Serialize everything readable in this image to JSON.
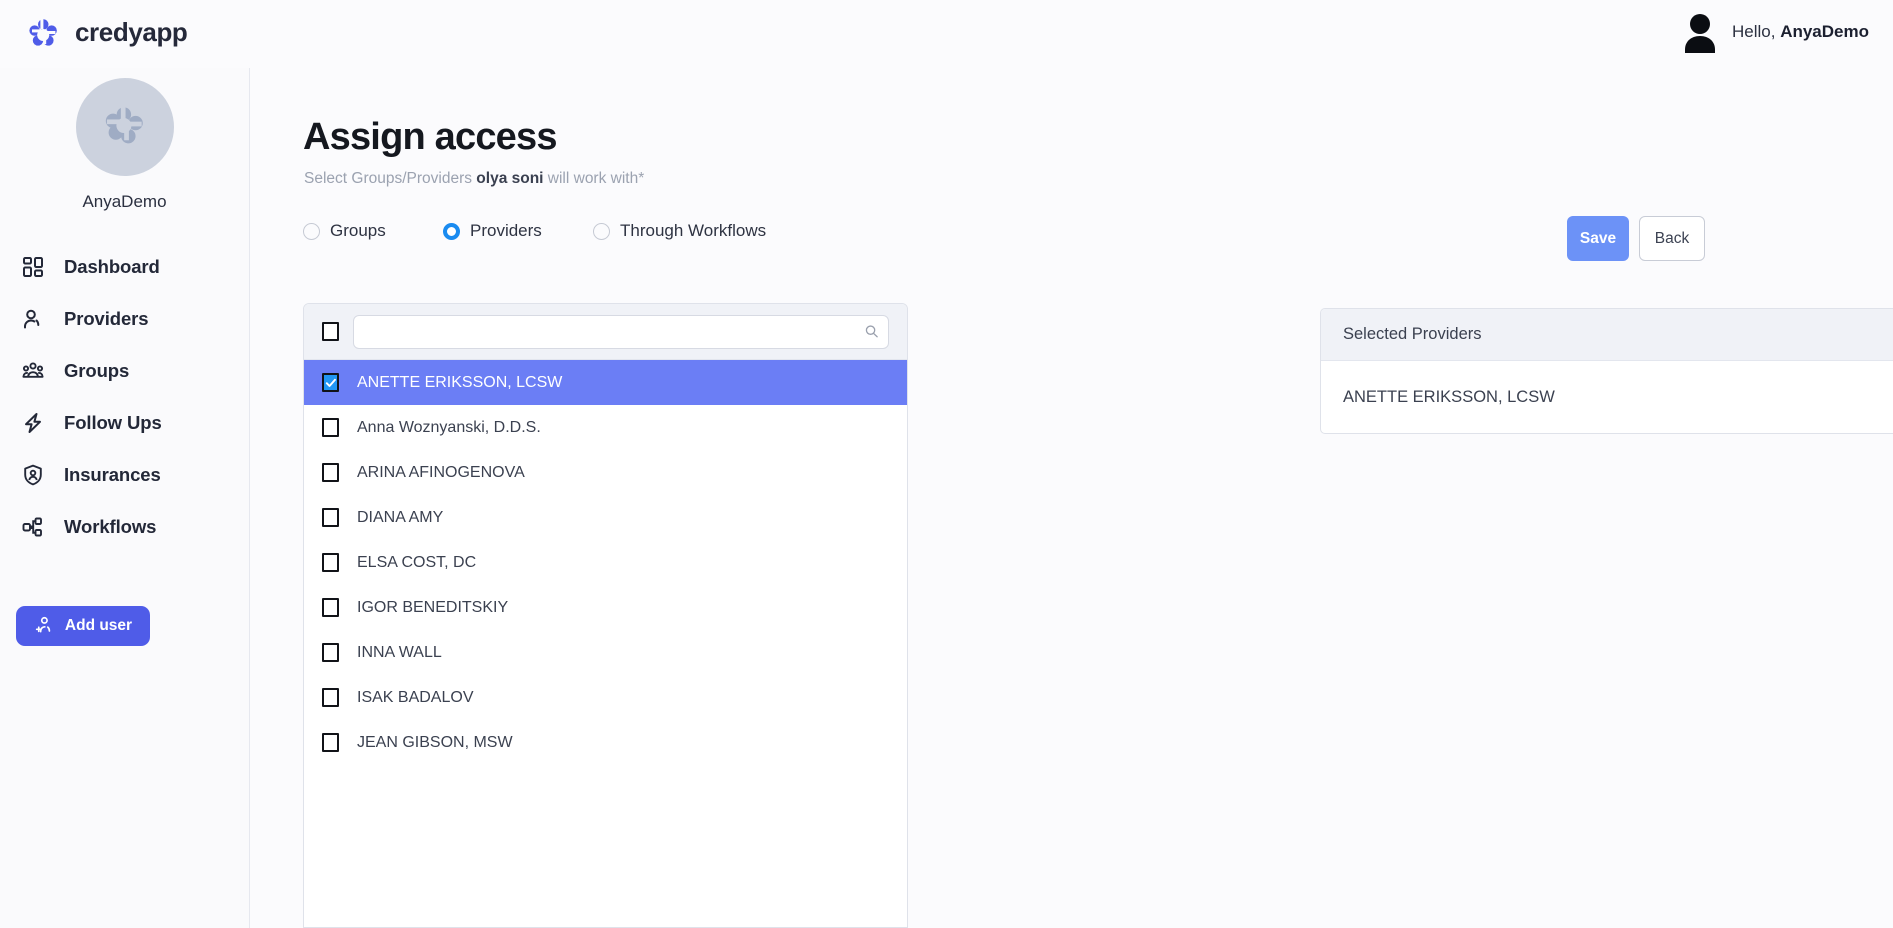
{
  "brand": {
    "name": "credyapp",
    "logo_icon": "credyapp-pinwheel-logo",
    "accent_color": "#4f5ce8"
  },
  "topbar": {
    "greeting_prefix": "Hello, ",
    "greeting_user": "AnyaDemo",
    "avatar_icon": "user-silhouette-icon"
  },
  "sidebar": {
    "profile": {
      "name": "AnyaDemo",
      "avatar_icon": "credyapp-pinwheel-avatar"
    },
    "items": [
      {
        "label": "Dashboard",
        "icon": "grid-dashboard-icon"
      },
      {
        "label": "Providers",
        "icon": "person-icon"
      },
      {
        "label": "Groups",
        "icon": "people-group-icon"
      },
      {
        "label": "Follow Ups",
        "icon": "lightning-bolt-icon"
      },
      {
        "label": "Insurances",
        "icon": "shield-person-icon"
      },
      {
        "label": "Workflows",
        "icon": "workflow-nodes-icon"
      }
    ],
    "add_user": {
      "label": "Add user",
      "icon": "person-plus-icon"
    }
  },
  "main": {
    "title": "Assign access",
    "subtitle_prefix": "Select Groups/Providers ",
    "subtitle_bold": "olya soni",
    "subtitle_suffix": " will work with*",
    "radios": [
      {
        "label": "Groups",
        "selected": false
      },
      {
        "label": "Providers",
        "selected": true
      },
      {
        "label": "Through Workflows",
        "selected": false
      }
    ],
    "radio_selected_color": "#1a8bf0",
    "buttons": {
      "save_label": "Save",
      "save_color": "#6c92f7",
      "back_label": "Back"
    },
    "list_panel": {
      "select_all_checked": false,
      "search_value": "",
      "search_placeholder": "",
      "search_icon": "magnifier-search-icon",
      "selected_row_color": "#6b7ef5",
      "rows": [
        {
          "label": "ANETTE ERIKSSON, LCSW",
          "checked": true
        },
        {
          "label": "Anna Woznyanski, D.D.S.",
          "checked": false
        },
        {
          "label": "ARINA AFINOGENOVA",
          "checked": false
        },
        {
          "label": "DIANA AMY",
          "checked": false
        },
        {
          "label": "ELSA COST, DC",
          "checked": false
        },
        {
          "label": "IGOR BENEDITSKIY",
          "checked": false
        },
        {
          "label": "INNA WALL",
          "checked": false
        },
        {
          "label": "ISAK BADALOV",
          "checked": false
        },
        {
          "label": "JEAN GIBSON, MSW",
          "checked": false
        }
      ]
    },
    "selected_panel": {
      "header": "Selected Providers",
      "items": [
        {
          "label": "ANETTE ERIKSSON, LCSW"
        }
      ]
    }
  }
}
